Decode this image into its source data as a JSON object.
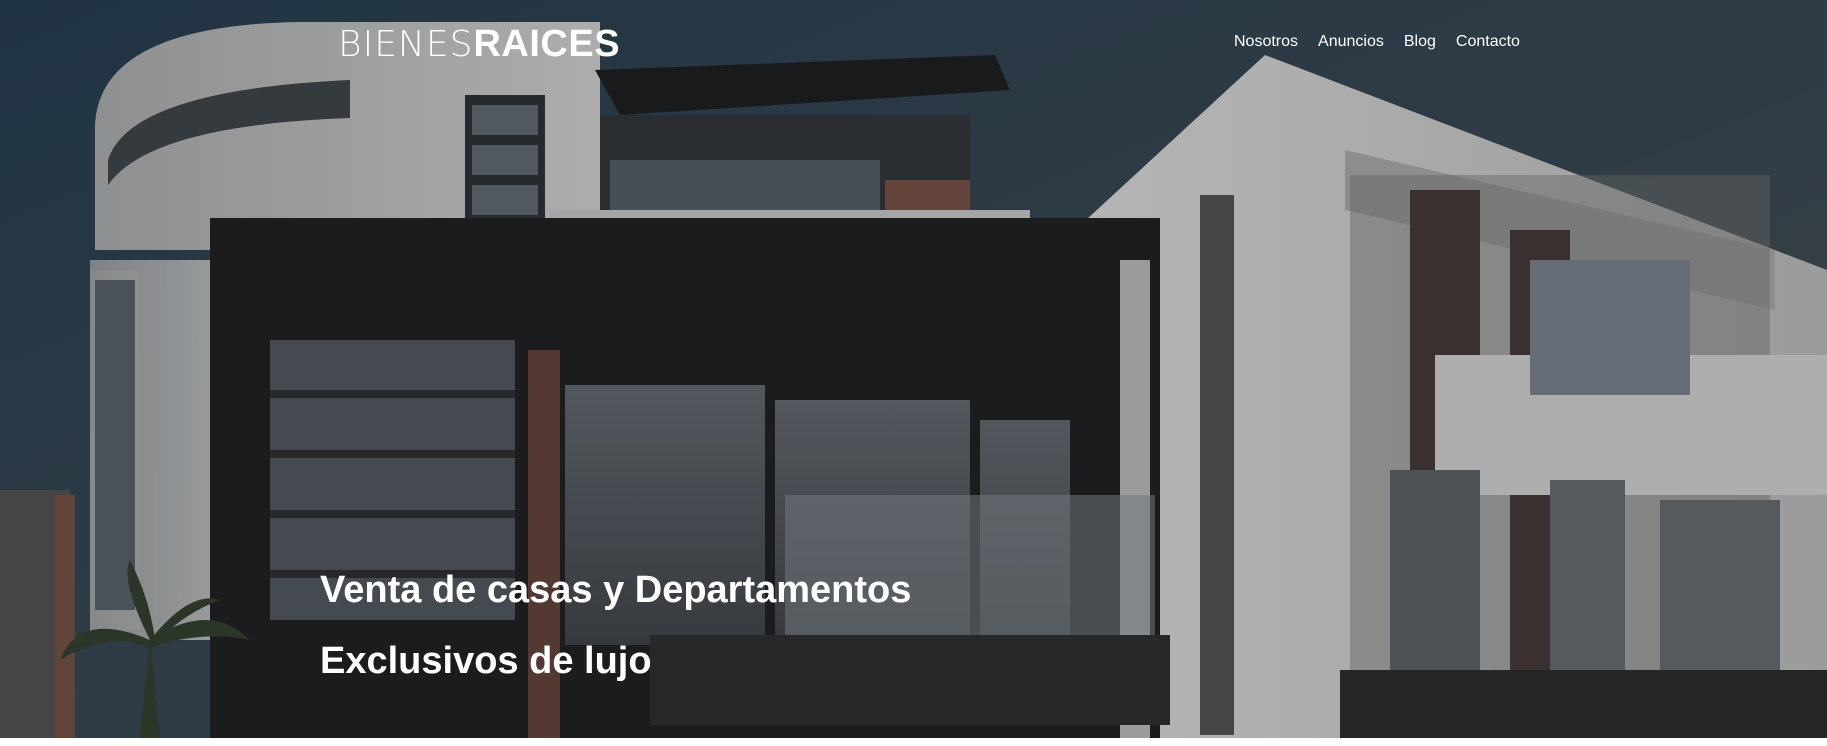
{
  "header": {
    "logo_light": "BIENES",
    "logo_bold": "RAICES"
  },
  "nav": {
    "items": [
      {
        "label": "Nosotros"
      },
      {
        "label": "Anuncios"
      },
      {
        "label": "Blog"
      },
      {
        "label": "Contacto"
      }
    ]
  },
  "hero": {
    "title": "Venta de casas y Departamentos",
    "subtitle": "Exclusivos de lujo",
    "image_description_icon": "building-photo"
  },
  "colors": {
    "text": "#ffffff",
    "sky": "#2b3a44",
    "building_light": "#bdbdbd",
    "building_dark": "#1d1e20"
  }
}
